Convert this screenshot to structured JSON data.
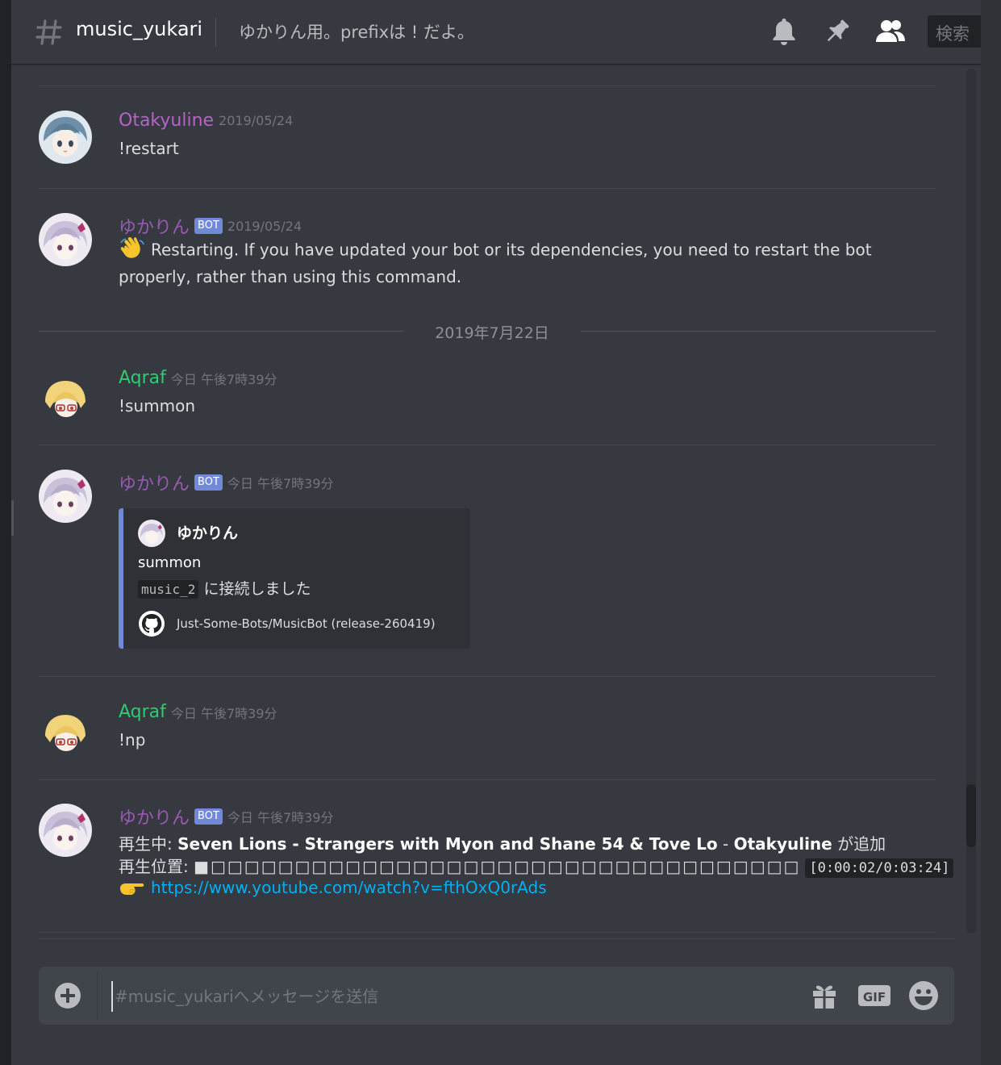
{
  "header": {
    "channel_name": "music_yukari",
    "topic": "ゆかりん用。prefixは ! だよ。",
    "search_placeholder": "検索"
  },
  "messages": [
    {
      "username": "Otakyuline",
      "user_color": "#b663c6",
      "timestamp": "2019/05/24",
      "bot": false,
      "content": "!restart"
    },
    {
      "username": "ゆかりん",
      "user_color": "#9b59b6",
      "bot_badge": "BOT",
      "timestamp": "2019/05/24",
      "content": "Restarting. If you have updated your bot or its dependencies, you need to restart the bot properly, rather than using this command."
    },
    {
      "username": "Aqraf",
      "user_color": "#2ecc71",
      "timestamp": "今日 午後7時39分",
      "content": "!summon"
    },
    {
      "username": "ゆかりん",
      "bot_badge": "BOT",
      "timestamp": "今日 午後7時39分",
      "embed": {
        "author": "ゆかりん",
        "title": "summon",
        "desc_code": "music_2",
        "desc_text": "に接続しました",
        "footer": "Just-Some-Bots/MusicBot (release-260419)"
      }
    },
    {
      "username": "Aqraf",
      "timestamp": "今日 午後7時39分",
      "content": "!np"
    },
    {
      "username": "ゆかりん",
      "bot_badge": "BOT",
      "timestamp": "今日 午後7時39分",
      "now_playing": {
        "label": "再生中: ",
        "track": "Seven Lions - Strangers with Myon and Shane 54 & Tove Lo",
        "sep": " - ",
        "added_by": "Otakyuline",
        "added_suffix": " が追加",
        "position_label": "再生位置: ",
        "progress_bar": "■□□□□□□□□□□□□□□□□□□□□□□□□□□□□□□□□□□□",
        "time": "[0:00:02/0:03:24]",
        "link": "https://www.youtube.com/watch?v=fthOxQ0rAds"
      }
    }
  ],
  "date_divider": "2019年7月22日",
  "composer": {
    "placeholder": "#music_yukariへメッセージを送信"
  },
  "icons": [
    "hash-icon",
    "bell-icon",
    "pin-icon",
    "members-icon",
    "wave-icon",
    "github-icon",
    "point-icon",
    "attach-icon",
    "gift-icon",
    "gif-icon",
    "emoji-icon"
  ],
  "colors": {
    "background": "#36393f",
    "bot_badge": "#7289da",
    "link": "#00b0f4",
    "embed_accent": "#7289da"
  }
}
